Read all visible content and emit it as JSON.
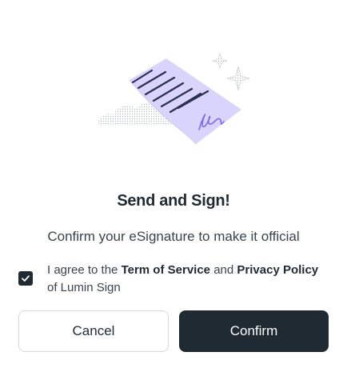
{
  "dialog": {
    "title": "Send and Sign!",
    "subtitle": "Confirm your eSignature to make it official",
    "agreement": {
      "checked": true,
      "prefix": "I agree to the",
      "terms_link": "Term of Service",
      "conjunction": "and",
      "privacy_link": "Privacy Policy",
      "suffix": "of Lumin Sign"
    },
    "buttons": {
      "cancel_label": "Cancel",
      "confirm_label": "Confirm"
    }
  },
  "colors": {
    "primary_dark": "#1f2a33",
    "illustration_paper": "#d9d4fb",
    "illustration_lines": "#2b2f52",
    "signature_stroke": "#7a6cf0",
    "cloud_dots": "#bfc3c7"
  },
  "icons": {
    "illustration": "document-signature-illustration",
    "checkbox": "checkmark-icon"
  }
}
